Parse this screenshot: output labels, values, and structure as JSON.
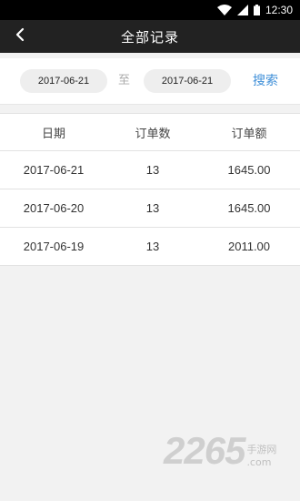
{
  "status_bar": {
    "time": "12:30",
    "icons": [
      "wifi-icon",
      "signal-icon",
      "battery-icon"
    ]
  },
  "nav": {
    "back_icon": "chevron-left-icon",
    "title": "全部记录"
  },
  "search": {
    "start_date": "2017-06-21",
    "to_label": "至",
    "end_date": "2017-06-21",
    "search_label": "搜索",
    "search_color": "#3f8fd8"
  },
  "table": {
    "headers": [
      "日期",
      "订单数",
      "订单额"
    ],
    "rows": [
      {
        "date": "2017-06-21",
        "count": "13",
        "amount": "1645.00"
      },
      {
        "date": "2017-06-20",
        "count": "13",
        "amount": "1645.00"
      },
      {
        "date": "2017-06-19",
        "count": "13",
        "amount": "2011.00"
      }
    ]
  },
  "watermark": {
    "logo": "2265",
    "sub": ".com",
    "site": "手游网"
  }
}
